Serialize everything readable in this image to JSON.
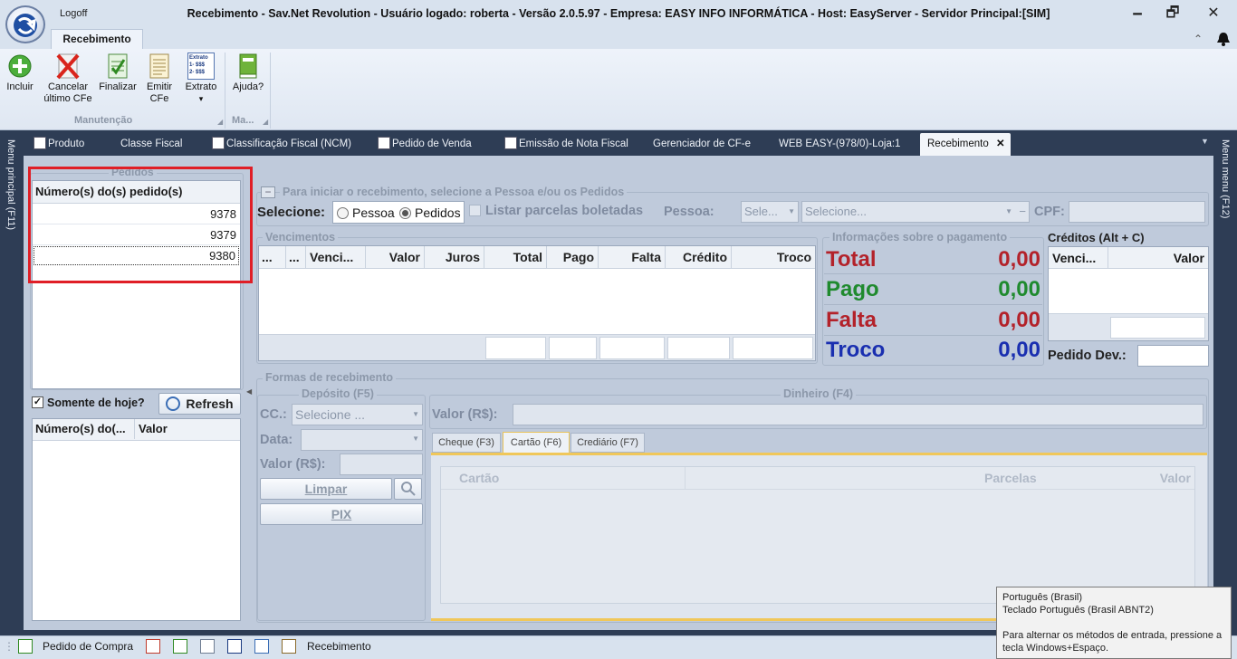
{
  "window": {
    "title": "Recebimento - Sav.Net Revolution - Usuário logado: roberta - Versão 2.0.5.97 - Empresa: EASY INFO INFORMÁTICA - Host: EasyServer - Servidor Principal:[SIM]",
    "logoff": "Logoff",
    "minimize": "🗕",
    "maximize": "🗗",
    "close": "✕"
  },
  "ribbon": {
    "tab": "Recebimento",
    "buttons": [
      {
        "label1": "Incluir",
        "label2": ""
      },
      {
        "label1": "Cancelar",
        "label2": "último CFe"
      },
      {
        "label1": "Finalizar",
        "label2": ""
      },
      {
        "label1": "Emitir",
        "label2": "CFe"
      },
      {
        "label1": "Extrato",
        "label2": "▾"
      },
      {
        "label1": "Ajuda?",
        "label2": ""
      }
    ],
    "extrato_icon_text": [
      "Extrato",
      "1- $$$",
      "2- $$$"
    ],
    "groups": [
      "Manutenção",
      "Ma..."
    ]
  },
  "tabs": [
    "Produto",
    "Classe Fiscal",
    "Classificação Fiscal (NCM)",
    "Pedido de Venda",
    "Emissão de Nota Fiscal",
    "Gerenciador de CF-e",
    "WEB EASY-(978/0)-Loja:1",
    "Recebimento"
  ],
  "tab_close": "✕",
  "side": {
    "left": "Menu principal (F11)",
    "right": "Menu menu (F12)"
  },
  "pedidos": {
    "legend": "Pedidos",
    "header": "Número(s) do(s) pedido(s)",
    "rows": [
      "9378",
      "9379",
      "9380"
    ],
    "somente_hoje": "Somente de hoje?",
    "refresh": "Refresh",
    "lower_headers": [
      "Número(s) do(...",
      "Valor"
    ]
  },
  "top": {
    "legend": "Para iniciar o recebimento, selecione a Pessoa e/ou os Pedidos",
    "selecione": "Selecione:",
    "radio_pessoa": "Pessoa",
    "radio_pedidos": "Pedidos",
    "listar": "Listar parcelas boletadas",
    "pessoa_label": "Pessoa:",
    "pessoa_select": "Sele...",
    "pessoa_select2": "Selecione...",
    "cpf": "CPF:"
  },
  "vencimentos": {
    "legend": "Vencimentos",
    "headers": [
      "...",
      "...",
      "Venci...",
      "Valor",
      "Juros",
      "Total",
      "Pago",
      "Falta",
      "Crédito",
      "Troco"
    ]
  },
  "info": {
    "legend": "Informações sobre o pagamento",
    "rows": [
      {
        "label": "Total",
        "value": "0,00",
        "color": "#b3222a"
      },
      {
        "label": "Pago",
        "value": "0,00",
        "color": "#1f8a2e"
      },
      {
        "label": "Falta",
        "value": "0,00",
        "color": "#b3222a"
      },
      {
        "label": "Troco",
        "value": "0,00",
        "color": "#1a2fb0"
      }
    ]
  },
  "creditos": {
    "title": "Créditos (Alt + C)",
    "headers": [
      "Venci...",
      "Valor"
    ],
    "pedido_dev": "Pedido Dev.:"
  },
  "formas": {
    "legend": "Formas de recebimento",
    "deposito": "Depósito (F5)",
    "cc": "CC.:",
    "cc_select": "Selecione ...",
    "data": "Data:",
    "valor": "Valor (R$):",
    "limpar": "Limpar",
    "pix": "PIX",
    "dinheiro": "Dinheiro (F4)",
    "din_valor": "Valor (R$):",
    "subtabs": [
      "Cheque (F3)",
      "Cartão (F6)",
      "Crediário (F7)"
    ],
    "cartao_headers": [
      "Cartão",
      "Parcelas",
      "Valor"
    ]
  },
  "status": {
    "pedido_compra": "Pedido de Compra",
    "recebimento": "Recebimento"
  },
  "tooltip": {
    "line1": "Português (Brasil)",
    "line2": "Teclado Português (Brasil ABNT2)",
    "line3": "Para alternar os métodos de entrada, pressione a tecla Windows+Espaço."
  },
  "colors": {
    "highlight": "#e01e26",
    "panel": "#bfcadb",
    "dark": "#2e3d55"
  }
}
